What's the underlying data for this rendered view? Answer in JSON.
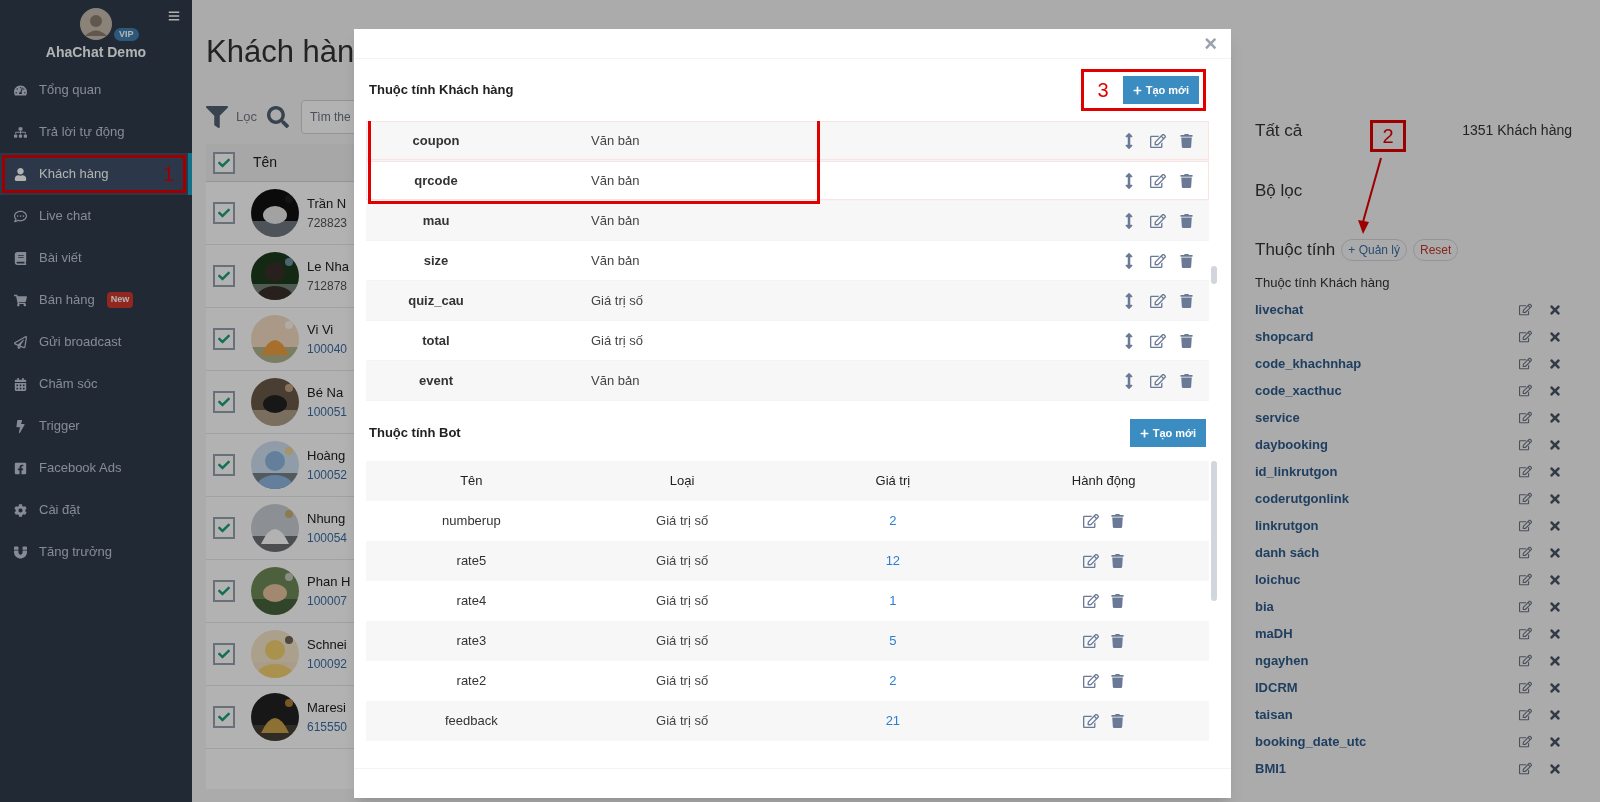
{
  "sidebar": {
    "user": {
      "name": "AhaChat Demo",
      "badge": "VIP"
    },
    "items": [
      {
        "label": "Tổng quan",
        "selected": false
      },
      {
        "label": "Trả lời tự động",
        "selected": false
      },
      {
        "label": "Khách hàng",
        "selected": true,
        "annotation": "1"
      },
      {
        "label": "Live chat",
        "selected": false
      },
      {
        "label": "Bài viết",
        "selected": false
      },
      {
        "label": "Bán hàng",
        "selected": false,
        "badge": "New"
      },
      {
        "label": "Gửi broadcast",
        "selected": false
      },
      {
        "label": "Chăm sóc",
        "selected": false
      },
      {
        "label": "Trigger",
        "selected": false
      },
      {
        "label": "Facebook Ads",
        "selected": false
      },
      {
        "label": "Cài đặt",
        "selected": false
      },
      {
        "label": "Tăng trưởng",
        "selected": false
      }
    ]
  },
  "page": {
    "title": "Khách hàn",
    "filter_label": "Lọc",
    "search": {
      "placeholder": "Tìm the"
    },
    "table": {
      "header": {
        "checked": true,
        "label": "Tên"
      },
      "rows": [
        {
          "name": "Trần N",
          "id": "728823",
          "checked": true
        },
        {
          "name": "Le Nha",
          "id": "712878",
          "checked": true
        },
        {
          "name": "Vi Vi",
          "id": "100040",
          "checked": true
        },
        {
          "name": "Bé Na",
          "id": "100051",
          "checked": true
        },
        {
          "name": "Hoàng",
          "id": "100052",
          "checked": true
        },
        {
          "name": "Nhung",
          "id": "100054",
          "checked": true
        },
        {
          "name": "Phan H",
          "id": "100007",
          "checked": true
        },
        {
          "name": "Schnei",
          "id": "100092",
          "checked": true
        },
        {
          "name": "Maresi",
          "id": "615550",
          "checked": true
        }
      ]
    }
  },
  "right_panel": {
    "all_label": "Tất cả",
    "count": "1351 Khách hàng",
    "filter_label": "Bộ lọc",
    "attributes_label": "Thuộc tính",
    "manage_button": "+ Quản lý",
    "reset_button": "Reset",
    "annotation": "2",
    "group_label": "Thuộc tính Khách hàng",
    "attributes": [
      "livechat",
      "shopcard",
      "code_khachnhap",
      "code_xacthuc",
      "service",
      "daybooking",
      "id_linkrutgon",
      "coderutgonlink",
      "linkrutgon",
      "danh sách",
      "loichuc",
      "bia",
      "maDH",
      "ngayhen",
      "IDCRM",
      "taisan",
      "booking_date_utc",
      "BMI1"
    ]
  },
  "modal": {
    "close": "×",
    "customer_attributes": {
      "title": "Thuộc tính Khách hàng",
      "button": "Tạo mới",
      "annotation": "3",
      "rows": [
        {
          "name": "coupon",
          "type": "Văn bản",
          "highlighted": true
        },
        {
          "name": "qrcode",
          "type": "Văn bản",
          "highlighted": true
        },
        {
          "name": "mau",
          "type": "Văn bản",
          "highlighted": false
        },
        {
          "name": "size",
          "type": "Văn bản",
          "highlighted": false
        },
        {
          "name": "quiz_cau",
          "type": "Giá trị số",
          "highlighted": false
        },
        {
          "name": "total",
          "type": "Giá trị số",
          "highlighted": false
        },
        {
          "name": "event",
          "type": "Văn bản",
          "highlighted": false
        }
      ]
    },
    "bot_attributes": {
      "title": "Thuộc tính Bot",
      "button": "Tạo mới",
      "columns": [
        "Tên",
        "Loại",
        "Giá trị",
        "Hành động"
      ],
      "rows": [
        {
          "name": "numberup",
          "type": "Giá trị số",
          "value": "2"
        },
        {
          "name": "rate5",
          "type": "Giá trị số",
          "value": "12"
        },
        {
          "name": "rate4",
          "type": "Giá trị số",
          "value": "1"
        },
        {
          "name": "rate3",
          "type": "Giá trị số",
          "value": "5"
        },
        {
          "name": "rate2",
          "type": "Giá trị số",
          "value": "2"
        },
        {
          "name": "feedback",
          "type": "Giá trị số",
          "value": "21"
        }
      ]
    }
  }
}
